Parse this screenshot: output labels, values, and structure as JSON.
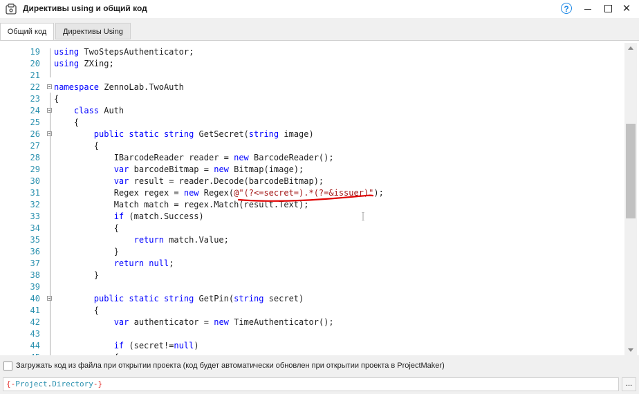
{
  "window": {
    "title": "Директивы using и общий код",
    "help": "?",
    "close": "✕"
  },
  "tabs": [
    {
      "label": "Общий код",
      "active": true
    },
    {
      "label": "Директивы Using",
      "active": false
    }
  ],
  "code_lines": [
    {
      "num": "19",
      "fold": false,
      "segments": [
        {
          "t": "using",
          "k": "kw"
        },
        {
          "t": " TwoStepsAuthenticator;",
          "k": "pl"
        }
      ]
    },
    {
      "num": "20",
      "fold": false,
      "segments": [
        {
          "t": "using",
          "k": "kw"
        },
        {
          "t": " ZXing;",
          "k": "pl"
        }
      ]
    },
    {
      "num": "21",
      "fold": false,
      "segments": []
    },
    {
      "num": "22",
      "fold": true,
      "segments": [
        {
          "t": "namespace",
          "k": "kw"
        },
        {
          "t": " ZennoLab.TwoAuth",
          "k": "pl"
        }
      ]
    },
    {
      "num": "23",
      "fold": false,
      "segments": [
        {
          "t": "{",
          "k": "pl"
        }
      ]
    },
    {
      "num": "24",
      "fold": true,
      "segments": [
        {
          "t": "    ",
          "k": "pl"
        },
        {
          "t": "class",
          "k": "kw"
        },
        {
          "t": " Auth",
          "k": "pl"
        }
      ]
    },
    {
      "num": "25",
      "fold": false,
      "segments": [
        {
          "t": "    {",
          "k": "pl"
        }
      ]
    },
    {
      "num": "26",
      "fold": true,
      "segments": [
        {
          "t": "        ",
          "k": "pl"
        },
        {
          "t": "public static string",
          "k": "kw"
        },
        {
          "t": " GetSecret(",
          "k": "pl"
        },
        {
          "t": "string",
          "k": "kw"
        },
        {
          "t": " image)",
          "k": "pl"
        }
      ]
    },
    {
      "num": "27",
      "fold": false,
      "segments": [
        {
          "t": "        {",
          "k": "pl"
        }
      ]
    },
    {
      "num": "28",
      "fold": false,
      "segments": [
        {
          "t": "            IBarcodeReader reader = ",
          "k": "pl"
        },
        {
          "t": "new",
          "k": "kw"
        },
        {
          "t": " BarcodeReader();",
          "k": "pl"
        }
      ]
    },
    {
      "num": "29",
      "fold": false,
      "segments": [
        {
          "t": "            ",
          "k": "pl"
        },
        {
          "t": "var",
          "k": "kw"
        },
        {
          "t": " barcodeBitmap = ",
          "k": "pl"
        },
        {
          "t": "new",
          "k": "kw"
        },
        {
          "t": " Bitmap(image);",
          "k": "pl"
        }
      ]
    },
    {
      "num": "30",
      "fold": false,
      "segments": [
        {
          "t": "            ",
          "k": "pl"
        },
        {
          "t": "var",
          "k": "kw"
        },
        {
          "t": " result = reader.Decode(barcodeBitmap);",
          "k": "pl"
        }
      ]
    },
    {
      "num": "31",
      "fold": false,
      "segments": [
        {
          "t": "            Regex regex = ",
          "k": "pl"
        },
        {
          "t": "new",
          "k": "kw"
        },
        {
          "t": " Regex(",
          "k": "pl"
        },
        {
          "t": "@\"(?<=secret=).*(?=&issuer)\"",
          "k": "str"
        },
        {
          "t": ");",
          "k": "pl"
        }
      ]
    },
    {
      "num": "32",
      "fold": false,
      "segments": [
        {
          "t": "            Match match = regex.Match(result.Text);",
          "k": "pl"
        }
      ]
    },
    {
      "num": "33",
      "fold": false,
      "segments": [
        {
          "t": "            ",
          "k": "pl"
        },
        {
          "t": "if",
          "k": "kw"
        },
        {
          "t": " (match.Success)",
          "k": "pl"
        }
      ]
    },
    {
      "num": "34",
      "fold": false,
      "segments": [
        {
          "t": "            {",
          "k": "pl"
        }
      ]
    },
    {
      "num": "35",
      "fold": false,
      "segments": [
        {
          "t": "                ",
          "k": "pl"
        },
        {
          "t": "return",
          "k": "kw"
        },
        {
          "t": " match.Value;",
          "k": "pl"
        }
      ]
    },
    {
      "num": "36",
      "fold": false,
      "segments": [
        {
          "t": "            }",
          "k": "pl"
        }
      ]
    },
    {
      "num": "37",
      "fold": false,
      "segments": [
        {
          "t": "            ",
          "k": "pl"
        },
        {
          "t": "return null",
          "k": "kw"
        },
        {
          "t": ";",
          "k": "pl"
        }
      ]
    },
    {
      "num": "38",
      "fold": false,
      "segments": [
        {
          "t": "        }",
          "k": "pl"
        }
      ]
    },
    {
      "num": "39",
      "fold": false,
      "segments": []
    },
    {
      "num": "40",
      "fold": true,
      "segments": [
        {
          "t": "        ",
          "k": "pl"
        },
        {
          "t": "public static string",
          "k": "kw"
        },
        {
          "t": " GetPin(",
          "k": "pl"
        },
        {
          "t": "string",
          "k": "kw"
        },
        {
          "t": " secret)",
          "k": "pl"
        }
      ]
    },
    {
      "num": "41",
      "fold": false,
      "segments": [
        {
          "t": "        {",
          "k": "pl"
        }
      ]
    },
    {
      "num": "42",
      "fold": false,
      "segments": [
        {
          "t": "            ",
          "k": "pl"
        },
        {
          "t": "var",
          "k": "kw"
        },
        {
          "t": " authenticator = ",
          "k": "pl"
        },
        {
          "t": "new",
          "k": "kw"
        },
        {
          "t": " TimeAuthenticator();",
          "k": "pl"
        }
      ]
    },
    {
      "num": "43",
      "fold": false,
      "segments": []
    },
    {
      "num": "44",
      "fold": false,
      "segments": [
        {
          "t": "            ",
          "k": "pl"
        },
        {
          "t": "if",
          "k": "kw"
        },
        {
          "t": " (secret!=",
          "k": "pl"
        },
        {
          "t": "null",
          "k": "kw"
        },
        {
          "t": ")",
          "k": "pl"
        }
      ]
    },
    {
      "num": "45",
      "fold": false,
      "segments": [
        {
          "t": "            {",
          "k": "pl"
        }
      ]
    }
  ],
  "bottom": {
    "load_checkbox_label": "Загружать код из файла при открытии проекта (код будет автоматически обновлен при открытии проекта в ProjectMaker)",
    "path_brace_open": "{-",
    "path_word1": "Project",
    "path_dot": ".",
    "path_word2": "Directory",
    "path_brace_close": "-}",
    "browse_label": "..."
  },
  "colors": {
    "keyword": "#0000ff",
    "string": "#a31515",
    "line_number": "#2b91af",
    "annotation": "#e53935"
  }
}
